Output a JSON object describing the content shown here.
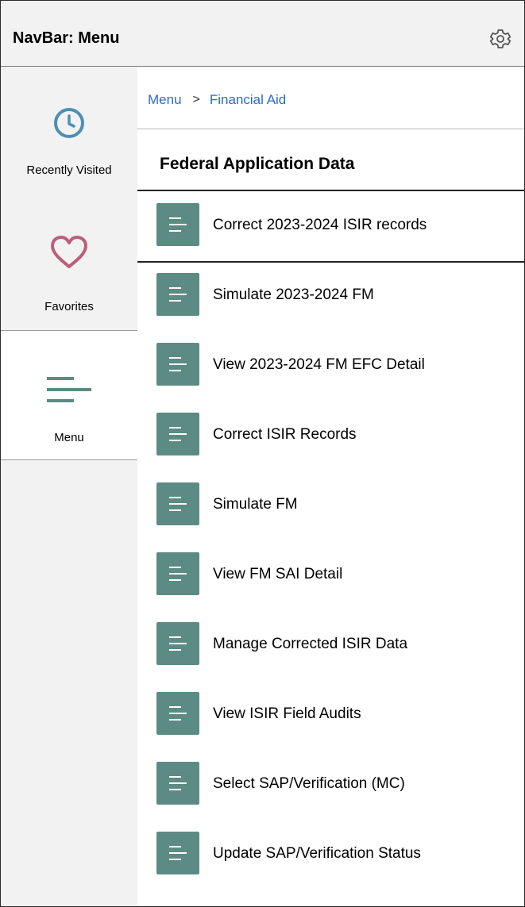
{
  "header": {
    "title": "NavBar: Menu",
    "settings_icon": "gear-icon"
  },
  "sidebar": {
    "items": [
      {
        "label": "Recently Visited",
        "icon": "clock-icon",
        "color": "#4e8fb2"
      },
      {
        "label": "Favorites",
        "icon": "heart-icon",
        "color": "#b8607a"
      },
      {
        "label": "Menu",
        "icon": "menu-lines-icon",
        "color": "#5b8b82",
        "active": true
      }
    ]
  },
  "breadcrumb": {
    "items": [
      "Menu",
      "Financial Aid"
    ],
    "separator": ">"
  },
  "section": {
    "title": "Federal Application Data"
  },
  "menu_items": [
    {
      "label": "Correct 2023-2024 ISIR records",
      "selected": true
    },
    {
      "label": "Simulate 2023-2024 FM"
    },
    {
      "label": "View 2023-2024 FM EFC Detail"
    },
    {
      "label": "Correct ISIR Records"
    },
    {
      "label": "Simulate FM"
    },
    {
      "label": "View FM SAI Detail"
    },
    {
      "label": "Manage Corrected ISIR Data"
    },
    {
      "label": "View ISIR Field Audits"
    },
    {
      "label": "Select SAP/Verification (MC)"
    },
    {
      "label": "Update SAP/Verification Status"
    }
  ],
  "colors": {
    "accent": "#5b8b82",
    "link": "#2b6cc9",
    "sidebar_bg": "#f2f2f2"
  }
}
